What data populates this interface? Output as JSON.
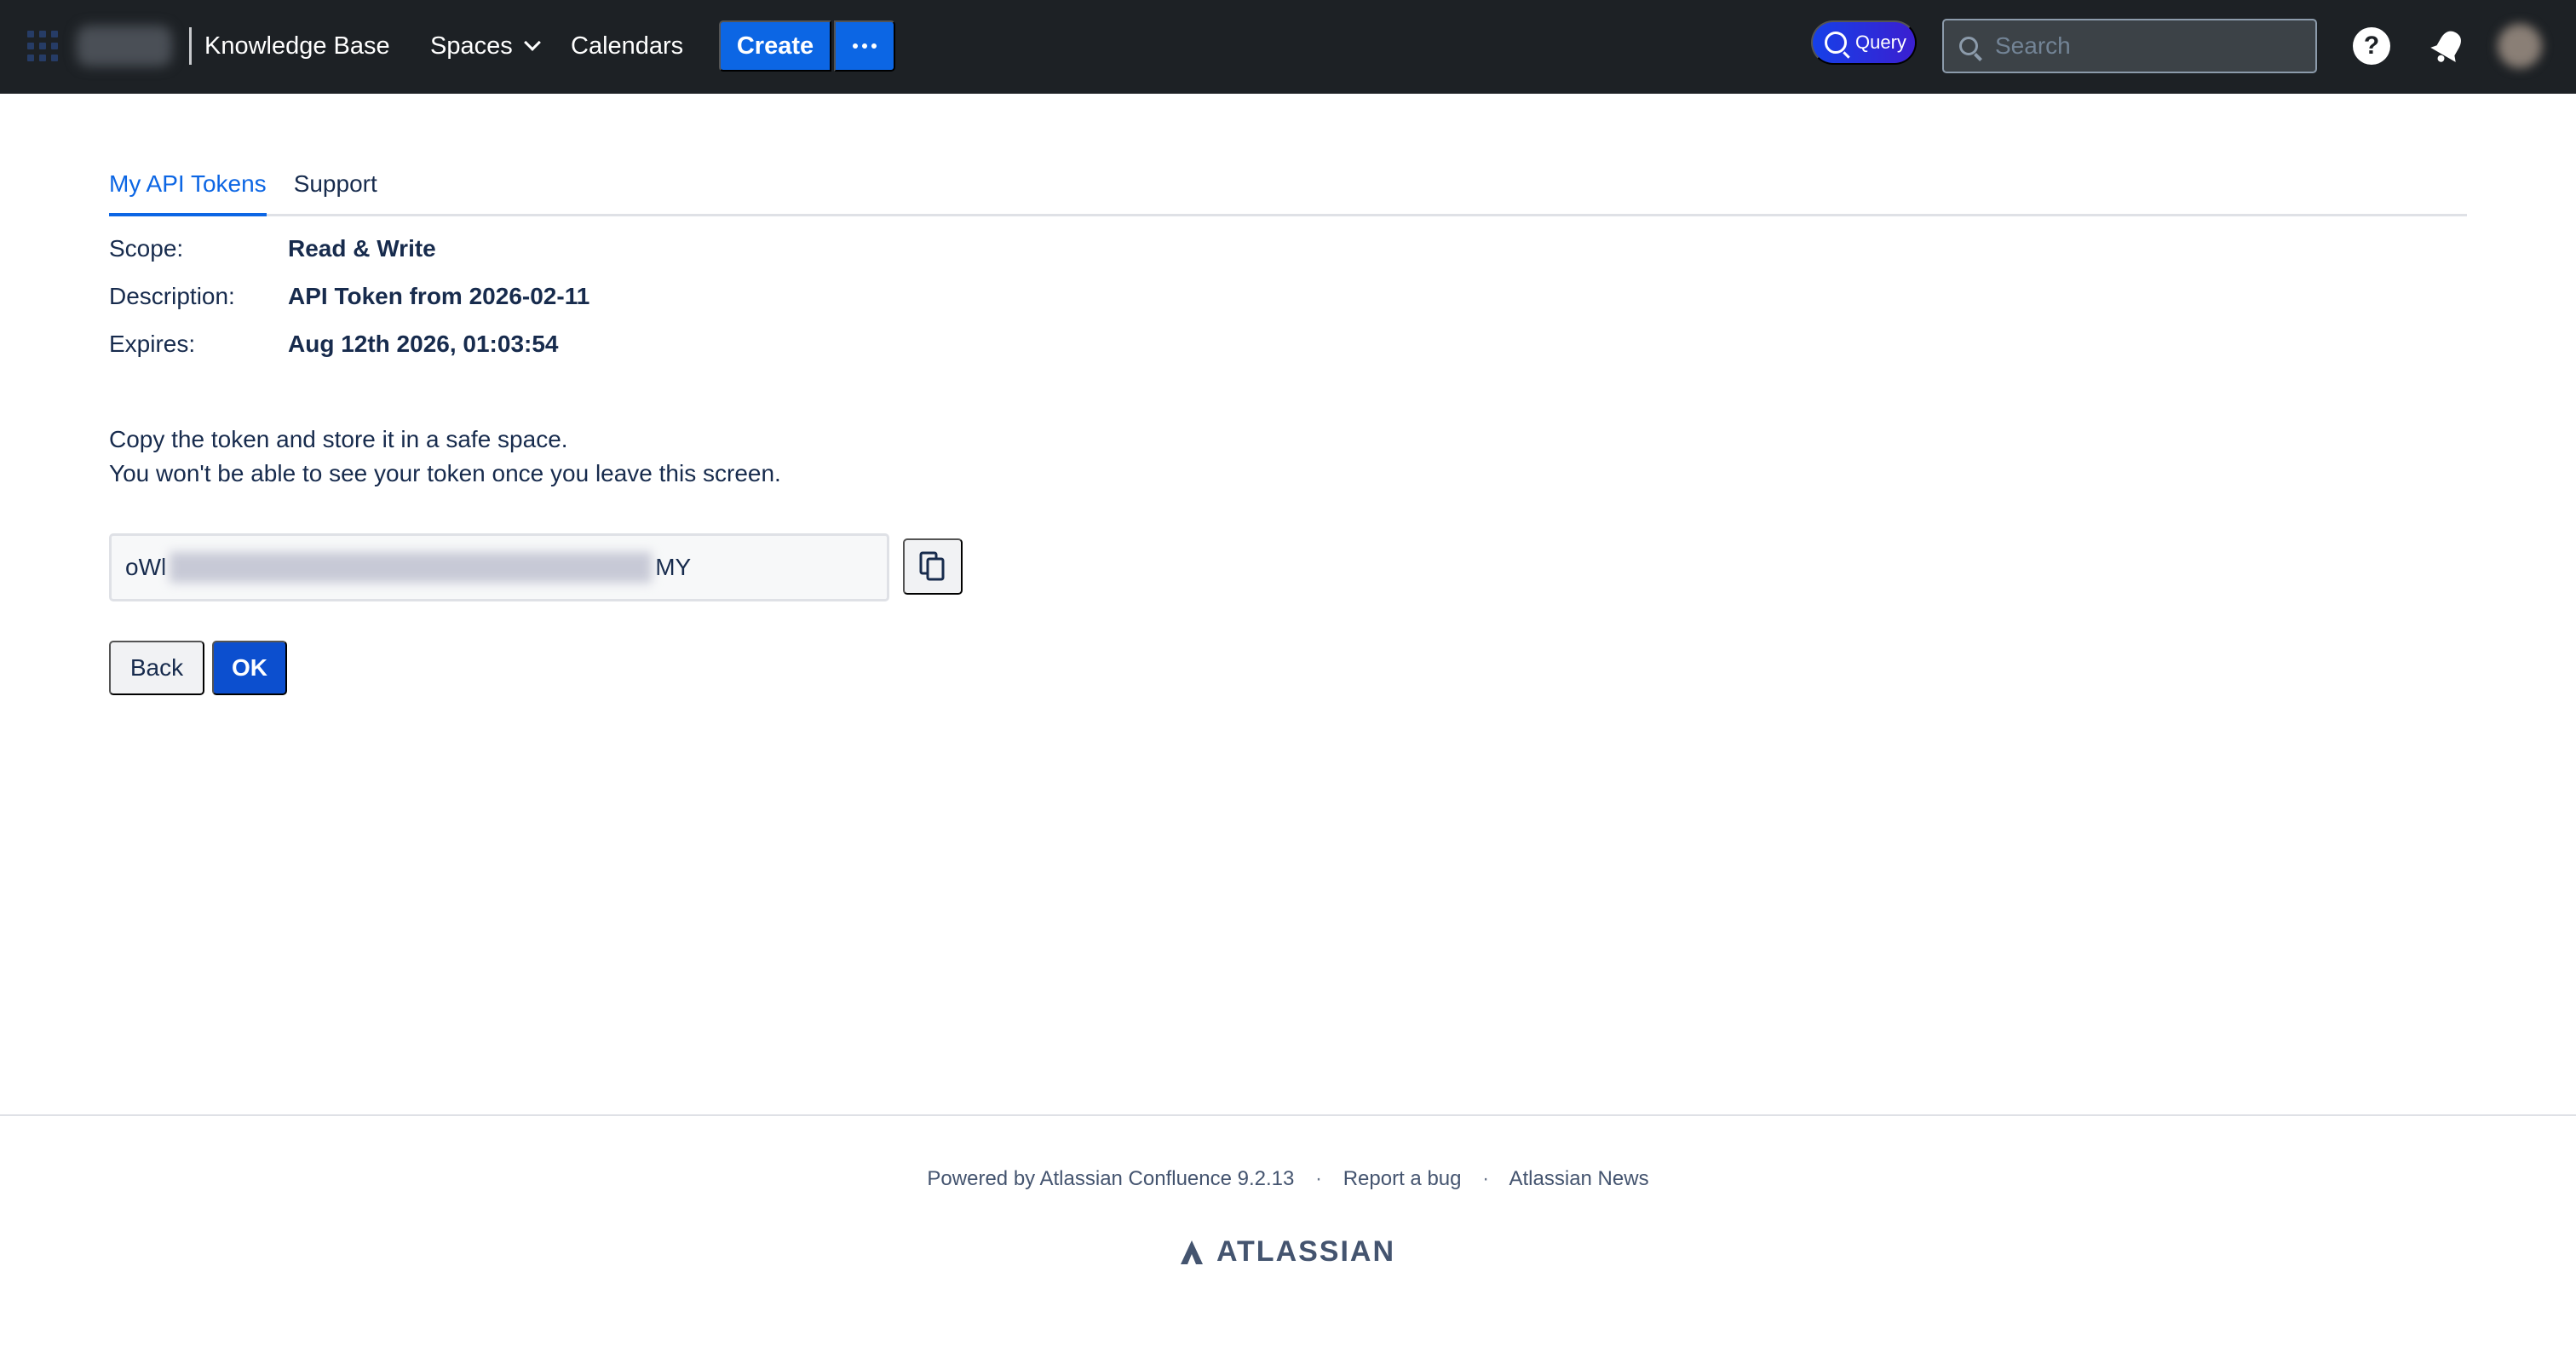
{
  "header": {
    "brand": "Knowledge Base",
    "nav": {
      "spaces_label": "Spaces",
      "calendars_label": "Calendars"
    },
    "create_label": "Create",
    "query_label": "Query",
    "search": {
      "placeholder": "Search",
      "value": ""
    },
    "help_label": "?"
  },
  "tabs": [
    {
      "label": "My API Tokens",
      "active": true
    },
    {
      "label": "Support",
      "active": false
    }
  ],
  "token": {
    "scope": {
      "label": "Scope:",
      "value": "Read & Write"
    },
    "description": {
      "label": "Description:",
      "value": "API Token from 2026-02-11"
    },
    "expires": {
      "label": "Expires:",
      "value": "Aug 12th 2026, 01:03:54"
    },
    "note_line1": "Copy the token and store it in a safe space.",
    "note_line2": "You won't be able to see your token once you leave this screen.",
    "value_prefix": "oWl",
    "value_suffix": "MY"
  },
  "buttons": {
    "back_label": "Back",
    "ok_label": "OK"
  },
  "footer": {
    "powered_by": "Powered by Atlassian Confluence 9.2.13",
    "report_bug": "Report a bug",
    "news": "Atlassian News",
    "separator": "·",
    "logo_text": "ATLASSIAN"
  },
  "colors": {
    "header_bg": "#1d2125",
    "primary": "#0c66e4",
    "ok_button": "#0c4fcf",
    "text": "#172b4d"
  }
}
